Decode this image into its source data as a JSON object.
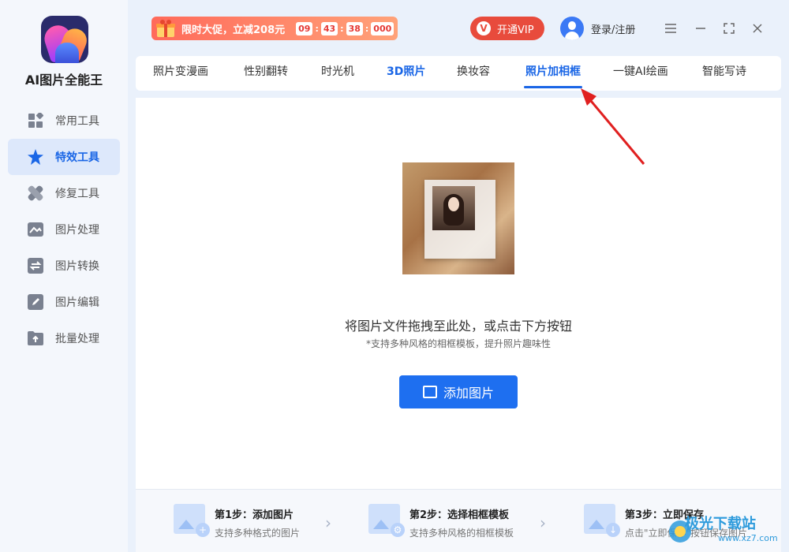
{
  "app": {
    "name": "AI图片全能王"
  },
  "sidebar": {
    "items": [
      {
        "label": "常用工具",
        "icon": "grid-icon"
      },
      {
        "label": "特效工具",
        "icon": "star-icon",
        "active": true
      },
      {
        "label": "修复工具",
        "icon": "bandage-icon"
      },
      {
        "label": "图片处理",
        "icon": "image-icon"
      },
      {
        "label": "图片转换",
        "icon": "convert-icon"
      },
      {
        "label": "图片编辑",
        "icon": "edit-icon"
      },
      {
        "label": "批量处理",
        "icon": "upload-icon"
      }
    ]
  },
  "topbar": {
    "promo_text": "限时大促，立减208元",
    "timer": [
      "09",
      "43",
      "38",
      "000"
    ],
    "vip_label": "开通VIP",
    "login_label": "登录/注册"
  },
  "tabs": [
    {
      "label": "照片变漫画"
    },
    {
      "label": "性别翻转"
    },
    {
      "label": "时光机"
    },
    {
      "label": "3D照片"
    },
    {
      "label": "换妆容"
    },
    {
      "label": "照片加相框",
      "active": true
    },
    {
      "label": "一键AI绘画"
    },
    {
      "label": "智能写诗"
    }
  ],
  "main": {
    "drop_text": "将图片文件拖拽至此处，或点击下方按钮",
    "drop_sub": "*支持多种风格的相框模板，提升照片趣味性",
    "add_button": "添加图片"
  },
  "steps": [
    {
      "title": "第1步：添加图片",
      "desc": "支持多种格式的图片"
    },
    {
      "title": "第2步：选择相框模板",
      "desc": "支持多种风格的相框模板"
    },
    {
      "title": "第3步：立即保存",
      "desc": "点击\"立即保存\"按钮保存图片"
    }
  ],
  "watermark": {
    "text": "极光下载站",
    "url": "www.xz7.com"
  },
  "colors": {
    "accent": "#1e6ff0",
    "vip": "#e84b3c",
    "promo": "#ff6a5a",
    "annotation": "#e02020"
  }
}
